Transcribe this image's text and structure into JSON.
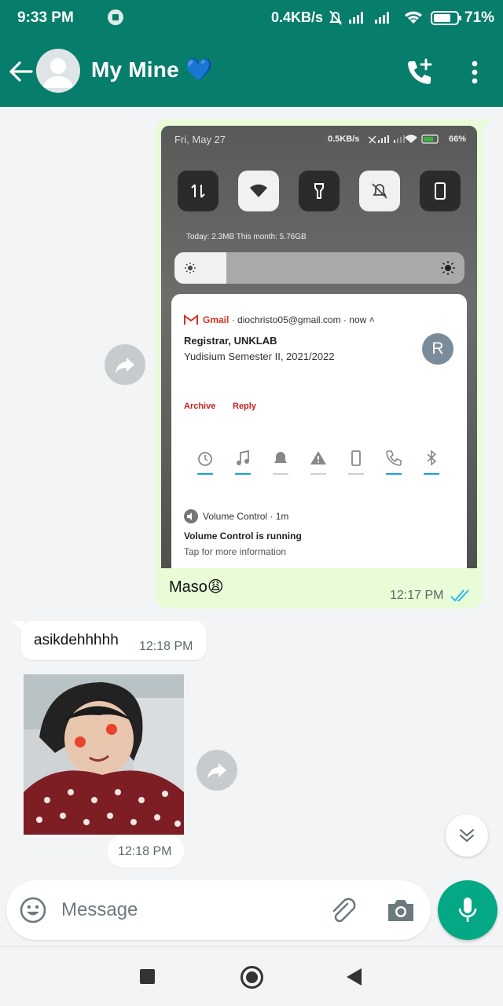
{
  "status_bar": {
    "time": "9:33 PM",
    "net_speed": "0.4KB/s",
    "battery_pct": "71%"
  },
  "header": {
    "contact_name": "My Mine 💙",
    "icons": [
      "back-arrow-icon",
      "avatar-icon",
      "add-call-icon",
      "more-vert-icon"
    ]
  },
  "messages": {
    "outgoing_image": {
      "caption": "Maso😩",
      "time": "12:17 PM",
      "status": "read",
      "screenshot": {
        "date": "Fri, May 27",
        "net_speed": "0.5KB/s",
        "battery": "66%",
        "data_usage": "Today: 2.3MB     This month: 5.76GB",
        "gmail": {
          "app": "Gmail",
          "account": "· diochristo05@gmail.com · now ˄",
          "title": "Registrar, UNKLAB",
          "body": "Yudisium Semester II, 2021/2022",
          "avatar_letter": "R",
          "action_archive": "Archive",
          "action_reply": "Reply"
        },
        "volume_notif": {
          "app": "Volume Control · 1m",
          "title": "Volume Control is running",
          "body": "Tap for more information"
        }
      }
    },
    "incoming_text": {
      "text": "asikdehhhhh",
      "time": "12:18 PM"
    },
    "incoming_photo": {
      "time": "12:18 PM"
    }
  },
  "composer": {
    "placeholder": "Message"
  },
  "colors": {
    "header": "#077d6b",
    "outgoing_bubble": "#e7fcd7",
    "mic_button": "#05a884",
    "read_ticks": "#34b7f1"
  }
}
